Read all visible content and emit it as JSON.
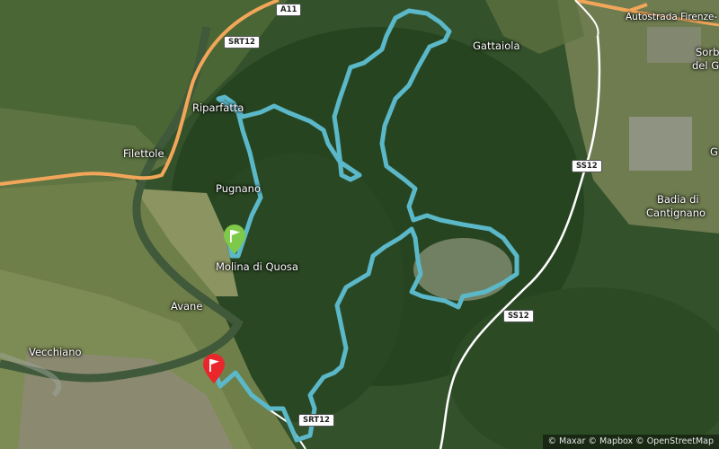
{
  "map": {
    "colors": {
      "route": "#5bb8c9",
      "motorway": "#f2a65a",
      "main_road": "#ffffff",
      "start_flag": "#7ec84a",
      "end_flag": "#e8262b"
    }
  },
  "places": {
    "riparfatta": "Riparfatta",
    "filettole": "Filettole",
    "pugnano": "Pugnano",
    "molina": "Molina di Quosa",
    "avane": "Avane",
    "vecchiano": "Vecchiano",
    "gattaiola": "Gattaiola",
    "badia": "Badia di",
    "cantignano": "Cantignano",
    "sorb": "Sorb",
    "del_gi": "del Gi",
    "g": "G"
  },
  "roads": {
    "a11": "A11",
    "srt12_top": "SRT12",
    "srt12_bottom": "SRT12",
    "ss12_top": "SS12",
    "ss12_bottom": "SS12",
    "autostrada": "Autostrada Firenze-"
  },
  "markers": {
    "start": "start-flag",
    "end": "end-flag"
  },
  "attribution": "© Maxar © Mapbox © OpenStreetMap"
}
